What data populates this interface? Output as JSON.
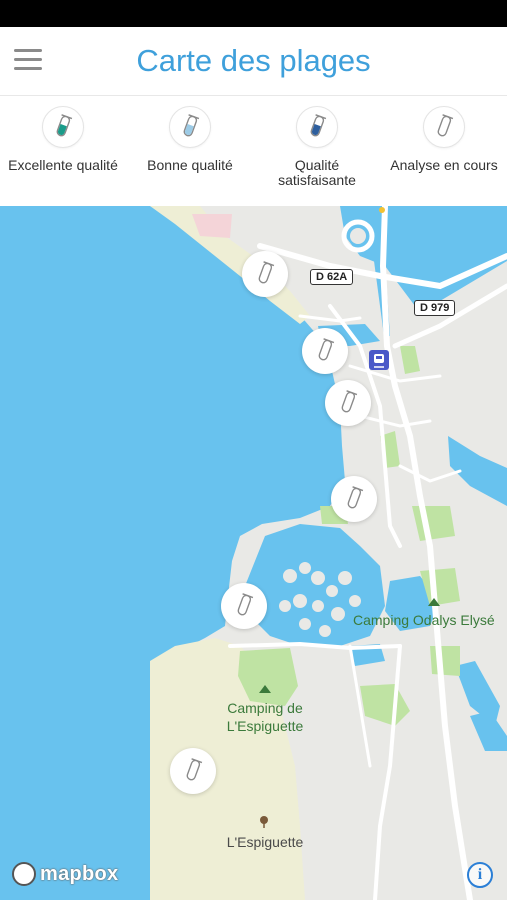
{
  "header": {
    "title": "Carte des plages",
    "menu_icon": "hamburger-menu-icon"
  },
  "legend": {
    "items": [
      {
        "label": "Excellente qualité",
        "icon": "test-tube-icon",
        "color": "#1a9c8a"
      },
      {
        "label": "Bonne qualité",
        "icon": "test-tube-icon",
        "color": "#9ccbe6"
      },
      {
        "label": "Qualité satisfaisante",
        "icon": "test-tube-icon",
        "color": "#2e5f9e"
      },
      {
        "label": "Analyse en cours",
        "icon": "test-tube-icon",
        "color": "#ffffff"
      }
    ]
  },
  "map": {
    "roads": [
      "D 62A",
      "D 979"
    ],
    "places": {
      "camping_odalys": "Camping Odalys Elysé",
      "camping_espiguette": "Camping de L'Espiguette",
      "espiguette": "L'Espiguette"
    },
    "pins_status": "Analyse en cours",
    "attribution": "mapbox",
    "info": "i",
    "colors": {
      "water": "#68c2ee",
      "land": "#e9e9e6",
      "sand": "#eeeed5",
      "park": "#bfe3a3",
      "road": "#ffffff",
      "title": "#3fa0db"
    }
  }
}
